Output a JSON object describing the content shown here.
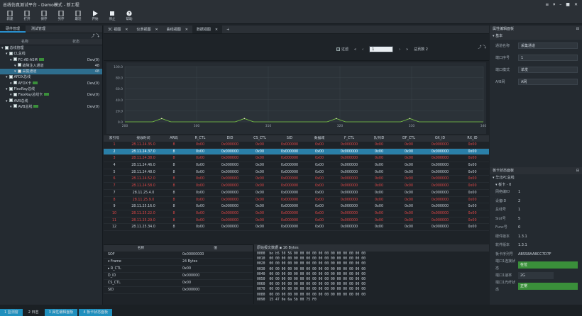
{
  "window": {
    "title": "总线仿真测试平台 - Demo模式 - 新工程",
    "controls": [
      "≡",
      "▾",
      "–",
      "■",
      "✕"
    ]
  },
  "toolbar": [
    {
      "label": "新建",
      "icon": "new-file-icon"
    },
    {
      "label": "打开",
      "icon": "open-folder-icon"
    },
    {
      "label": "保存",
      "icon": "save-icon"
    },
    {
      "label": "另存",
      "icon": "save-as-icon"
    },
    {
      "label": "最近",
      "icon": "recent-icon"
    },
    {
      "label": "开始",
      "icon": "play-icon"
    },
    {
      "label": "停止",
      "icon": "stop-icon"
    },
    {
      "label": "帮助",
      "icon": "help-icon"
    }
  ],
  "left": {
    "tabs": [
      "硬件管理",
      "测试管理"
    ],
    "cols": [
      "名称",
      "状态"
    ],
    "tree": [
      {
        "name": "总线管理",
        "status": "",
        "indent": 0,
        "box": true
      },
      {
        "name": "CL总线",
        "status": "",
        "indent": 1,
        "box": true
      },
      {
        "name": "FC-AE-ASM",
        "status": "Dev(0)",
        "indent": 2,
        "box": true,
        "tag": true
      },
      {
        "name": "故障注入通道",
        "status": "48",
        "indent": 3,
        "box": true
      },
      {
        "name": "采集通道",
        "status": "48",
        "indent": 3,
        "box": true,
        "sel": true
      },
      {
        "name": "AFDX总线",
        "status": "",
        "indent": 1,
        "box": true
      },
      {
        "name": "AFDX卡",
        "status": "Dev(0)",
        "indent": 2,
        "box": true,
        "tag": true
      },
      {
        "name": "FlexRay总线",
        "status": "",
        "indent": 1,
        "box": true
      },
      {
        "name": "FlexRay总线卡",
        "status": "Dev(0)",
        "indent": 2,
        "box": true,
        "tag": true
      },
      {
        "name": "AVB总线",
        "status": "",
        "indent": 1,
        "box": true
      },
      {
        "name": "AVB总线",
        "status": "Dev(0)",
        "indent": 2,
        "box": true,
        "tag": true
      }
    ]
  },
  "center": {
    "tabs": [
      {
        "label": "3C 视图",
        "close": "✕"
      },
      {
        "label": "仪表视图",
        "close": "✕"
      },
      {
        "label": "曲线视图",
        "close": "✕"
      },
      {
        "label": "数据视图",
        "close": "✕",
        "on": true
      }
    ],
    "add": "+"
  },
  "controls": {
    "filter": "过滤",
    "first": "«",
    "prev": "‹",
    "page": "1",
    "next": "›",
    "last": "»",
    "total": "总页数 2"
  },
  "chart_data": {
    "type": "line",
    "y_ticks": [
      "100.0",
      "80.0",
      "60.0",
      "40.0",
      "20.0",
      "0.0"
    ],
    "x_ticks": [
      "200",
      "300",
      "310",
      "320",
      "330",
      "340"
    ],
    "ylim": [
      0,
      100
    ],
    "series": [
      {
        "values": [
          0,
          0,
          0,
          0,
          6,
          0,
          0,
          0,
          0,
          0,
          0,
          0,
          0,
          6,
          0,
          0,
          0,
          0,
          0,
          0,
          0,
          0,
          0,
          6,
          0,
          0,
          0,
          0,
          0,
          0,
          0,
          6,
          0,
          0,
          0,
          0,
          0,
          0,
          0,
          0
        ]
      }
    ]
  },
  "grid": {
    "cols": [
      "索引号",
      "接收时间",
      "AR码",
      "R_CTL",
      "DID",
      "CS_CTL",
      "SID",
      "数据域",
      "F_CTL",
      "队列ID",
      "DF_CTL",
      "OX_ID",
      "RX_ID"
    ],
    "rows": [
      [
        "1",
        "28.11.24.35.0",
        "8",
        "0x00",
        "0x000000",
        "0x00",
        "0x000000",
        "0x00",
        "0x000000",
        "0x00",
        "0x00",
        "0x000000",
        "0x00"
      ],
      [
        "2",
        "28.11.24.37.0",
        "8",
        "0x00",
        "0x000000",
        "0x00",
        "0x000000",
        "0x00",
        "0x000000",
        "0x00",
        "0x00",
        "0x000000",
        "0x00"
      ],
      [
        "3",
        "28.11.24.38.0",
        "8",
        "0x00",
        "0x000000",
        "0x00",
        "0x000000",
        "0x00",
        "0x000000",
        "0x00",
        "0x00",
        "0x000000",
        "0x00"
      ],
      [
        "4",
        "28.11.24.46.0",
        "8",
        "0x00",
        "0x000000",
        "0x00",
        "0x000000",
        "0x00",
        "0x000000",
        "0x00",
        "0x00",
        "0x000000",
        "0x00"
      ],
      [
        "5",
        "28.11.24.48.0",
        "8",
        "0x00",
        "0x000000",
        "0x00",
        "0x000000",
        "0x00",
        "0x000000",
        "0x00",
        "0x00",
        "0x000000",
        "0x00"
      ],
      [
        "6",
        "28.11.24.52.0",
        "8",
        "0x00",
        "0x000000",
        "0x00",
        "0x000000",
        "0x00",
        "0x000000",
        "0x00",
        "0x00",
        "0x000000",
        "0x00"
      ],
      [
        "7",
        "28.11.24.58.0",
        "8",
        "0x00",
        "0x000000",
        "0x00",
        "0x000000",
        "0x00",
        "0x000000",
        "0x00",
        "0x00",
        "0x000000",
        "0x00"
      ],
      [
        "7",
        "28.11.25.4.0",
        "8",
        "0x00",
        "0x000000",
        "0x00",
        "0x000000",
        "0x00",
        "0x000000",
        "0x00",
        "0x00",
        "0x000000",
        "0x00"
      ],
      [
        "8",
        "28.11.25.9.0",
        "8",
        "0x00",
        "0x000000",
        "0x00",
        "0x000000",
        "0x00",
        "0x000000",
        "0x00",
        "0x00",
        "0x000000",
        "0x00"
      ],
      [
        "9",
        "28.11.25.16.0",
        "8",
        "0x00",
        "0x000000",
        "0x00",
        "0x000000",
        "0x00",
        "0x000000",
        "0x00",
        "0x00",
        "0x000000",
        "0x00"
      ],
      [
        "10",
        "28.11.25.22.0",
        "8",
        "0x00",
        "0x000000",
        "0x00",
        "0x000000",
        "0x00",
        "0x000000",
        "0x00",
        "0x00",
        "0x000000",
        "0x00"
      ],
      [
        "11",
        "28.11.25.29.0",
        "8",
        "0x00",
        "0x000000",
        "0x00",
        "0x000000",
        "0x00",
        "0x000000",
        "0x00",
        "0x00",
        "0x000000",
        "0x00"
      ],
      [
        "12",
        "28.11.25.34.0",
        "8",
        "0x00",
        "0x000000",
        "0x00",
        "0x000000",
        "0x00",
        "0x000000",
        "0x00",
        "0x00",
        "0x000000",
        "0x00"
      ]
    ],
    "red_rows": [
      0,
      2,
      5,
      6,
      8,
      10,
      11
    ],
    "hl_row": 1
  },
  "props": {
    "cols": [
      "名称",
      "值"
    ],
    "rows": [
      [
        "SOF",
        "0x00000000"
      ],
      [
        "▾ Frame",
        "24 Bytes"
      ],
      [
        "▸ R_CTL",
        "0x00"
      ],
      [
        "D_ID",
        "0x000000"
      ],
      [
        "CS_CTL",
        "0x00"
      ],
      [
        "SID",
        "0x000000"
      ]
    ]
  },
  "hex": {
    "title": "原始报文数据 ▪  16 Bytes",
    "lines": [
      "0000  bo b5 50 56 00 00 00 00 00 00 00 00 00 00 00 00",
      "0010  00 00 00 00 00 00 00 00 00 00 00 00 00 00 00 00",
      "0020  00 00 00 00 00 00 00 00 00 00 00 00 00 00 00 00",
      "0030  00 00 00 00 00 00 00 00 00 00 00 00 00 00 00 00",
      "0040  00 00 00 00 00 00 00 00 00 00 00 00 00 00 00 00",
      "0050  00 00 00 00 00 00 00 00 00 00 00 00 00 00 00 00",
      "0060  00 00 00 00 00 00 00 00 00 00 00 00 00 00 00 00",
      "0070  00 00 00 00 00 00 00 00 00 00 00 00 00 00 00 00",
      "0080  00 00 00 00 00 00 00 00 00 00 00 00 00 00 00 00",
      "0090  15 47 0e 6a 5b 00 75 F0"
    ]
  },
  "right1": {
    "title": "属性编辑面板",
    "section": "▾ 基本",
    "rows": [
      [
        "通道名称",
        "采集通道"
      ],
      [
        "端口序号",
        "1"
      ],
      [
        "端口模式",
        "单发"
      ],
      [
        "A/B网",
        "A网"
      ]
    ]
  },
  "right2": {
    "title": "板卡状态面板",
    "g1": "▾ 华北PC总线",
    "g2": "▾ 板卡 - 0",
    "rows": [
      [
        "网络编ID",
        "1"
      ],
      [
        "设备ID",
        "2"
      ],
      [
        "总线号",
        "1"
      ],
      [
        "Slot号",
        "5"
      ],
      [
        "Func号",
        "0"
      ],
      [
        "硬件版本",
        "1.3.1"
      ],
      [
        "软件版本",
        "1.3.1"
      ],
      [
        "板卡序列号",
        "ABSS8AABCC7D7F"
      ]
    ],
    "status": [
      [
        "端口1连接状态",
        "在位"
      ],
      [
        "端口1速率",
        "2G"
      ],
      [
        "端口1光纤状态",
        "正常"
      ]
    ]
  },
  "status": [
    "1 监测窗",
    "2 日志",
    "3 属性编辑面板",
    "4 板卡状态面板"
  ]
}
